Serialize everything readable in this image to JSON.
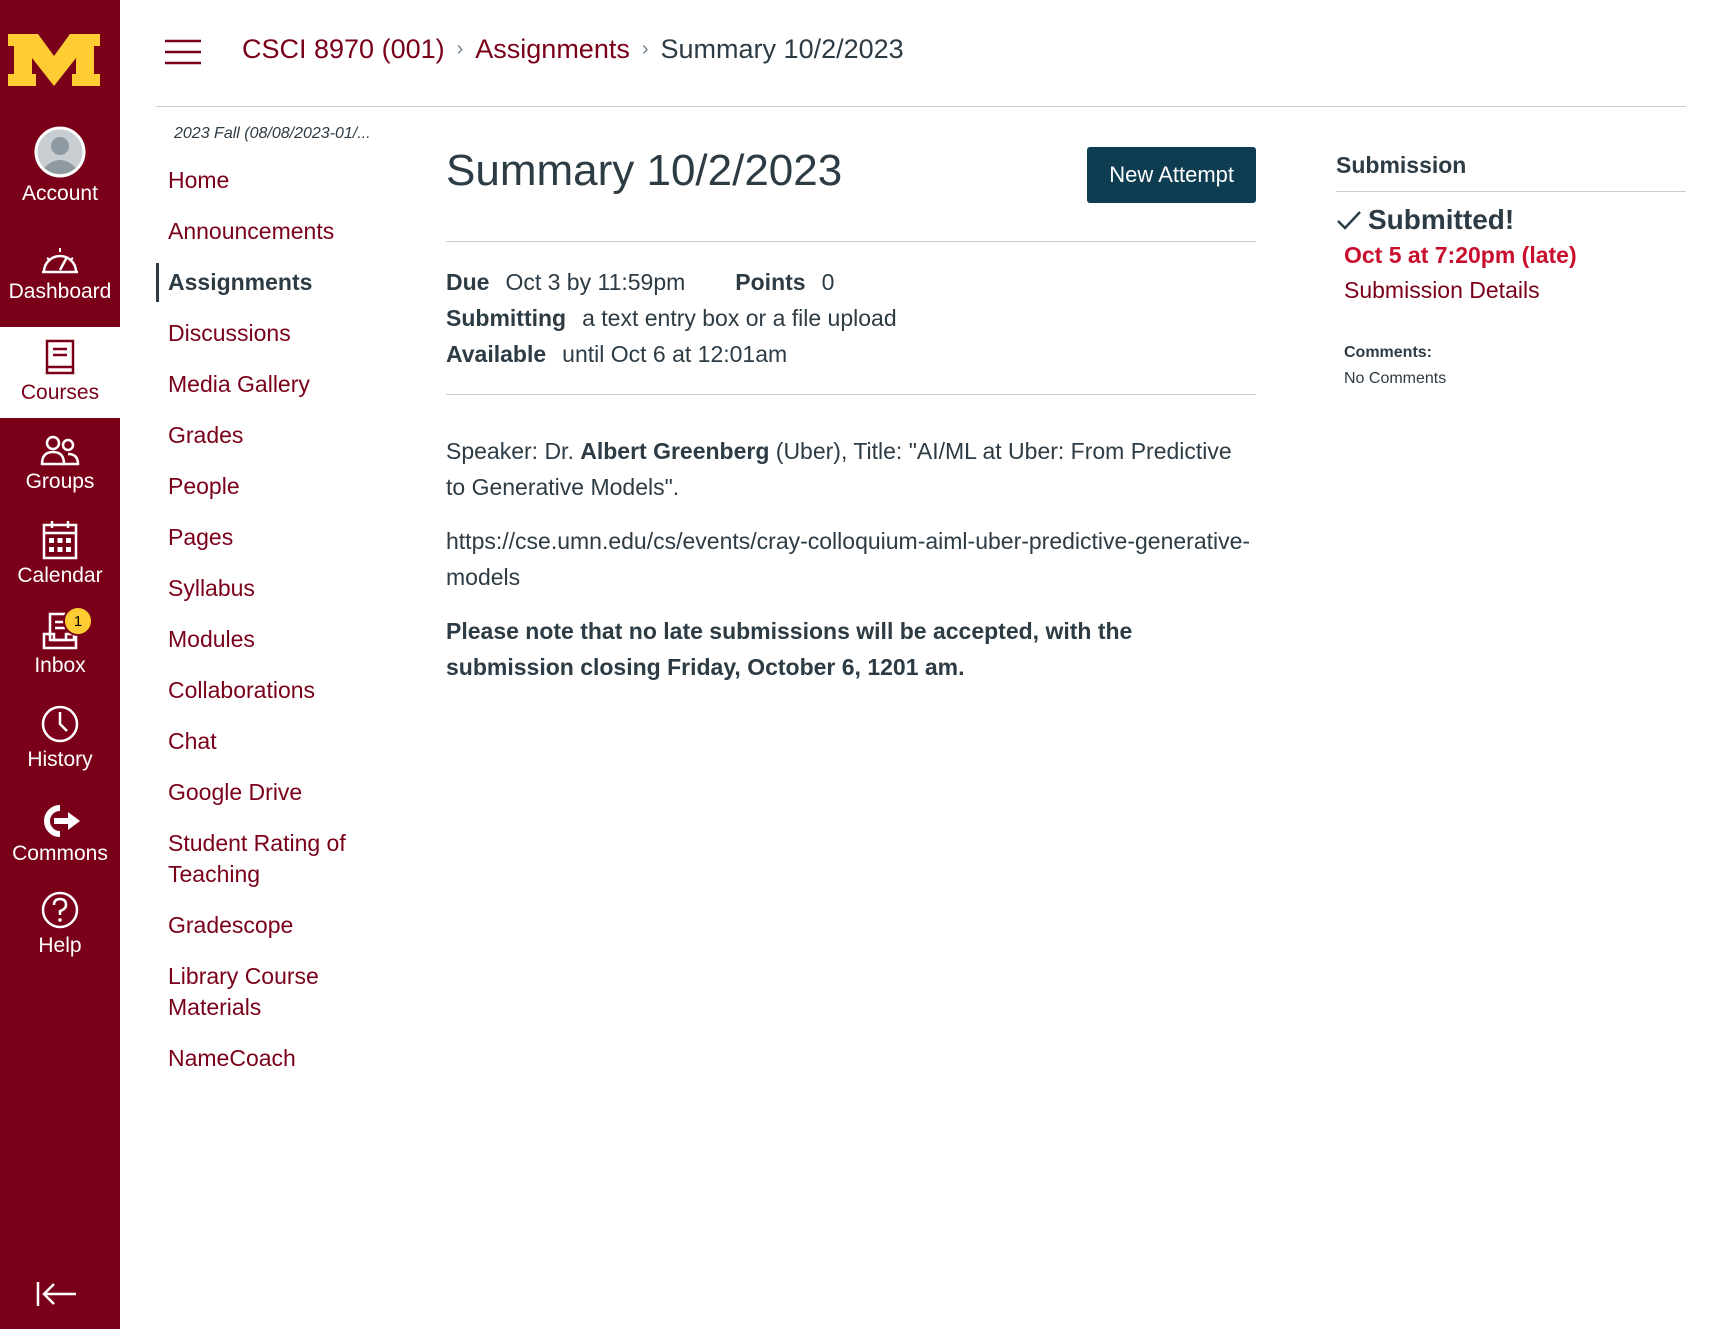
{
  "global_nav": {
    "items": [
      {
        "label": "Account",
        "icon": "user-avatar-icon"
      },
      {
        "label": "Dashboard",
        "icon": "speedometer-icon"
      },
      {
        "label": "Courses",
        "icon": "book-icon"
      },
      {
        "label": "Groups",
        "icon": "people-icon"
      },
      {
        "label": "Calendar",
        "icon": "calendar-icon"
      },
      {
        "label": "Inbox",
        "icon": "inbox-icon",
        "badge": "1"
      },
      {
        "label": "History",
        "icon": "clock-icon"
      },
      {
        "label": "Commons",
        "icon": "commons-icon"
      },
      {
        "label": "Help",
        "icon": "help-icon"
      }
    ],
    "brand_color": "#7a0019",
    "badge_color": "#ffcc33"
  },
  "breadcrumb": {
    "course": "CSCI 8970 (001)",
    "section": "Assignments",
    "current": "Summary 10/2/2023"
  },
  "course_nav": {
    "term": "2023 Fall (08/08/2023-01/...",
    "items": [
      "Home",
      "Announcements",
      "Assignments",
      "Discussions",
      "Media Gallery",
      "Grades",
      "People",
      "Pages",
      "Syllabus",
      "Modules",
      "Collaborations",
      "Chat",
      "Google Drive",
      "Student Rating of Teaching",
      "Gradescope",
      "Library Course Materials",
      "NameCoach"
    ],
    "active": "Assignments"
  },
  "assignment": {
    "title": "Summary 10/2/2023",
    "new_attempt_label": "New Attempt",
    "due_label": "Due",
    "due_value": "Oct 3 by 11:59pm",
    "points_label": "Points",
    "points_value": "0",
    "submitting_label": "Submitting",
    "submitting_value": "a text entry box or a file upload",
    "available_label": "Available",
    "available_value": "until Oct 6 at 12:01am",
    "desc_speaker_prefix": "Speaker: Dr. ",
    "desc_speaker_name": "Albert Greenberg",
    "desc_speaker_suffix": " (Uber), Title: \"AI/ML at Uber: From Predictive to Generative Models\".",
    "desc_url": "https://cse.umn.edu/cs/events/cray-colloquium-aiml-uber-predictive-generative-models",
    "desc_note": "Please note that no late submissions will be accepted, with the submission closing Friday, October 6, 1201 am."
  },
  "submission": {
    "title": "Submission",
    "status": "Submitted!",
    "submitted_at": "Oct 5 at 7:20pm (late)",
    "details_link": "Submission Details",
    "comments_label": "Comments:",
    "comments_value": "No Comments",
    "late_color": "#c8102e"
  }
}
